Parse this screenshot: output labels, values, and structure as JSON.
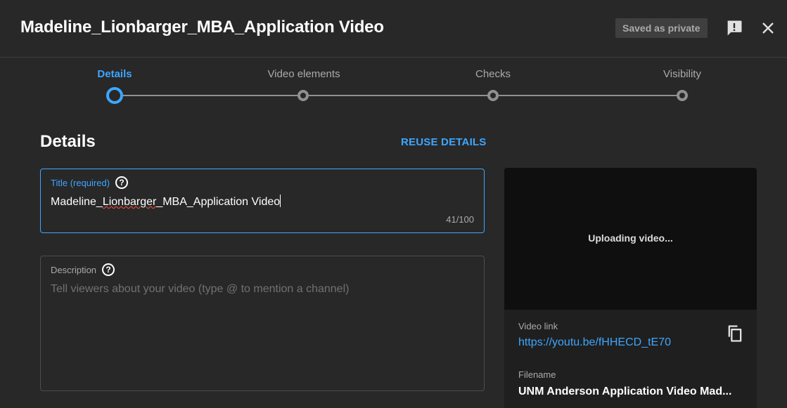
{
  "header": {
    "title": "Madeline_Lionbarger_MBA_Application Video",
    "saved_badge": "Saved as private",
    "icons": {
      "feedback": "feedback-icon",
      "close": "close-icon"
    }
  },
  "stepper": {
    "steps": [
      {
        "label": "Details",
        "state": "active"
      },
      {
        "label": "Video elements",
        "state": "inactive"
      },
      {
        "label": "Checks",
        "state": "inactive"
      },
      {
        "label": "Visibility",
        "state": "inactive"
      }
    ]
  },
  "details": {
    "heading": "Details",
    "reuse_label": "REUSE DETAILS",
    "title_field": {
      "label": "Title (required)",
      "value_prefix": "Madeline_",
      "value_misspelled": "Lionbarger",
      "value_suffix": "_MBA_Application Video",
      "counter": "41/100"
    },
    "description_field": {
      "label": "Description",
      "placeholder": "Tell viewers about your video (type @ to mention a channel)"
    }
  },
  "preview": {
    "status": "Uploading video...",
    "video_link_label": "Video link",
    "video_link": "https://youtu.be/fHHECD_tE70",
    "filename_label": "Filename",
    "filename": "UNM Anderson Application Video Mad..."
  },
  "colors": {
    "accent": "#3ea6ff",
    "background": "#282828",
    "player": "#0f0f0f",
    "panel": "#1f1f1f"
  }
}
